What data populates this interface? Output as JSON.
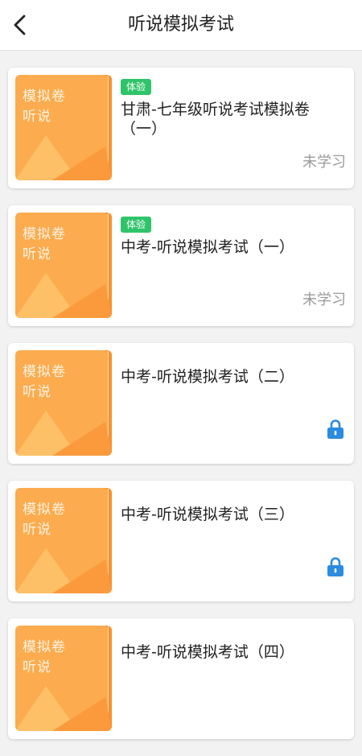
{
  "header": {
    "title": "听说模拟考试"
  },
  "cards": [
    {
      "cover_line1": "模拟卷",
      "cover_line2": "听说",
      "badge": "体验",
      "title": "甘肃-七年级听说考试模拟卷（一）",
      "status": "未学习"
    },
    {
      "cover_line1": "模拟卷",
      "cover_line2": "听说",
      "badge": "体验",
      "title": "中考-听说模拟考试（一）",
      "status": "未学习"
    },
    {
      "cover_line1": "模拟卷",
      "cover_line2": "听说",
      "title": "中考-听说模拟考试（二）"
    },
    {
      "cover_line1": "模拟卷",
      "cover_line2": "听说",
      "title": "中考-听说模拟考试（三）"
    },
    {
      "cover_line1": "模拟卷",
      "cover_line2": "听说",
      "title": "中考-听说模拟考试（四）"
    }
  ],
  "colors": {
    "cover": "#fcab4e",
    "badge": "#2fc46a",
    "lock": "#2b8be0"
  },
  "icons": {
    "back": "chevron-left-icon",
    "lock": "lock-icon"
  }
}
